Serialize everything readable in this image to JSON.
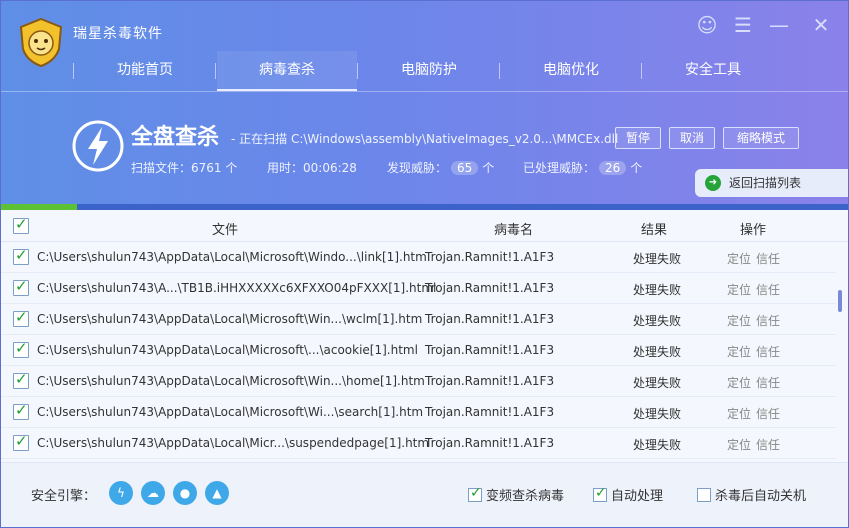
{
  "app": {
    "title": "瑞星杀毒软件"
  },
  "window_controls": {
    "skin": "☺",
    "menu": "☰",
    "minimize": "—",
    "close": "✕"
  },
  "nav": {
    "items": [
      {
        "label": "功能首页"
      },
      {
        "label": "病毒查杀",
        "active": true
      },
      {
        "label": "电脑防护"
      },
      {
        "label": "电脑优化"
      },
      {
        "label": "安全工具"
      }
    ]
  },
  "scan": {
    "title": "全盘查杀",
    "status": "- 正在扫描 C:\\Windows\\assembly\\NativeImages_v2.0...\\MMCEx.dll",
    "pause_label": "暂停",
    "cancel_label": "取消",
    "compact_label": "缩略模式",
    "files_label": "扫描文件：6761 个",
    "time_label": "用时：00:06:28",
    "threats_found_label": "发现威胁：",
    "threats_found": "65",
    "threats_handled_label": "已处理威胁：",
    "threats_handled": "26",
    "unit": "个",
    "back_label": "返回扫描列表",
    "progress": 0.09
  },
  "table": {
    "headers": {
      "file": "文件",
      "virus": "病毒名",
      "result": "结果",
      "action": "操作"
    },
    "rows": [
      {
        "file": "C:\\Users\\shulun743\\AppData\\Local\\Microsoft\\Windo...\\link[1].htm",
        "virus": "Trojan.Ramnit!1.A1F3",
        "result": "处理失败",
        "locate": "定位",
        "trust": "信任"
      },
      {
        "file": "C:\\Users\\shulun743\\A...\\TB1B.iHHXXXXXc6XFXXO04pFXXX[1].html",
        "virus": "Trojan.Ramnit!1.A1F3",
        "result": "处理失败",
        "locate": "定位",
        "trust": "信任"
      },
      {
        "file": "C:\\Users\\shulun743\\AppData\\Local\\Microsoft\\Win...\\wclm[1].htm",
        "virus": "Trojan.Ramnit!1.A1F3",
        "result": "处理失败",
        "locate": "定位",
        "trust": "信任"
      },
      {
        "file": "C:\\Users\\shulun743\\AppData\\Local\\Microsoft\\...\\acookie[1].html",
        "virus": "Trojan.Ramnit!1.A1F3",
        "result": "处理失败",
        "locate": "定位",
        "trust": "信任"
      },
      {
        "file": "C:\\Users\\shulun743\\AppData\\Local\\Microsoft\\Win...\\home[1].htm",
        "virus": "Trojan.Ramnit!1.A1F3",
        "result": "处理失败",
        "locate": "定位",
        "trust": "信任"
      },
      {
        "file": "C:\\Users\\shulun743\\AppData\\Local\\Microsoft\\Wi...\\search[1].htm",
        "virus": "Trojan.Ramnit!1.A1F3",
        "result": "处理失败",
        "locate": "定位",
        "trust": "信任"
      },
      {
        "file": "C:\\Users\\shulun743\\AppData\\Local\\Micr...\\suspendedpage[1].htm",
        "virus": "Trojan.Ramnit!1.A1F3",
        "result": "处理失败",
        "locate": "定位",
        "trust": "信任"
      }
    ]
  },
  "footer": {
    "engine_label": "安全引擎：",
    "engines": [
      "lightning-engine-icon",
      "cloud-engine-icon",
      "user-engine-icon",
      "drive-engine-icon"
    ],
    "options": [
      {
        "label": "变频查杀病毒",
        "checked": true
      },
      {
        "label": "自动处理",
        "checked": true
      },
      {
        "label": "杀毒后自动关机",
        "checked": false
      }
    ]
  },
  "colors": {
    "accent": "#6c86ea",
    "progress": "#5cc134",
    "check": "#1f9e2e"
  }
}
